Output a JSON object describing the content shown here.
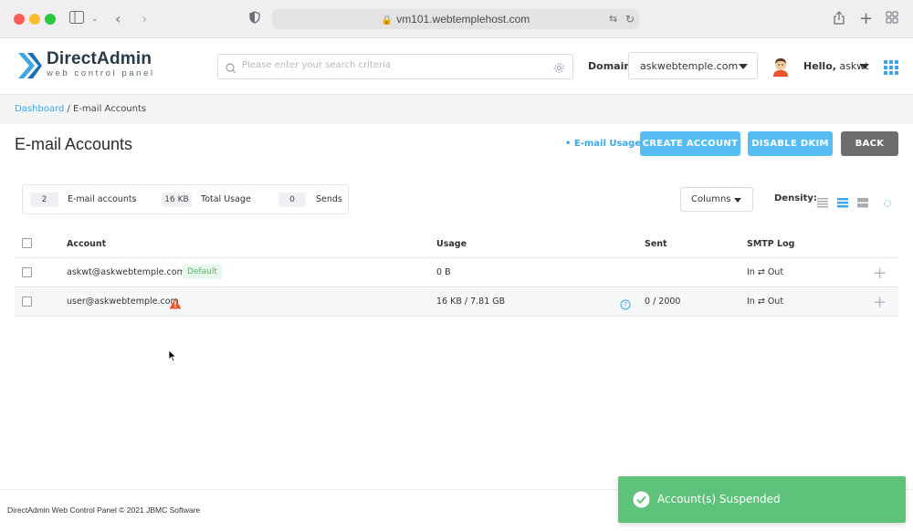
{
  "browser": {
    "url": "vm101.webtemplehost.com"
  },
  "header": {
    "logo_title": "DirectAdmin",
    "logo_subtitle": "web control panel",
    "search_placeholder": "Please enter your search criteria",
    "domain_label": "Domain",
    "domain_value": "askwebtemple.com",
    "hello_prefix": "Hello,",
    "username": "askwt"
  },
  "breadcrumb": {
    "dashboard": "Dashboard",
    "separator": " / ",
    "current": "E-mail Accounts"
  },
  "page": {
    "title": "E-mail Accounts",
    "usage_link": "• E-mail Usage",
    "create_account": "CREATE ACCOUNT",
    "disable_dkim": "DISABLE DKIM",
    "back": "BACK"
  },
  "stats": {
    "accounts_count": "2",
    "accounts_label": "E-mail accounts",
    "usage_value": "16 KB",
    "usage_label": "Total Usage",
    "sends_count": "0",
    "sends_label": "Sends"
  },
  "toolbar": {
    "columns_label": "Columns",
    "density_label": "Density:"
  },
  "table": {
    "headers": {
      "account": "Account",
      "usage": "Usage",
      "sent": "Sent",
      "smtp_log": "SMTP Log"
    },
    "rows": [
      {
        "account": "askwt@askwebtemple.com",
        "badge": "Default",
        "usage": "0 B",
        "sent": "",
        "smtp": "In ⇄ Out"
      },
      {
        "account": "user@askwebtemple.com",
        "badge": "",
        "usage": "16 KB / 7.81 GB",
        "sent": "0 / 2000",
        "smtp": "In ⇄ Out"
      }
    ]
  },
  "footer": {
    "text": "DirectAdmin Web Control Panel © 2021 JBMC Software"
  },
  "toast": {
    "message": "Account(s) Suspended"
  },
  "colors": {
    "accent": "#55bdf2",
    "link": "#3da5e8",
    "back_button": "#6d6d6d",
    "toast": "#5fc27a",
    "warning": "#e8552a"
  }
}
